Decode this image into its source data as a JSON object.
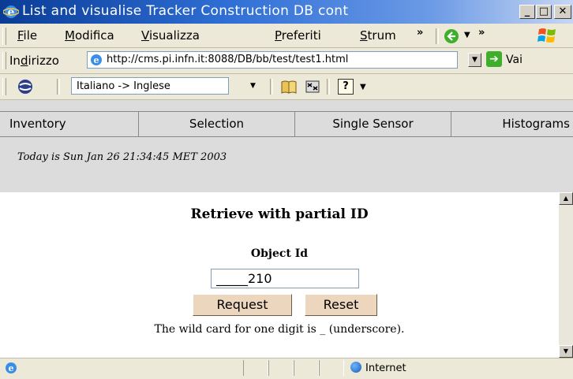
{
  "window": {
    "title": "List and visualise Tracker Construction DB cont",
    "buttons": [
      "_",
      "□",
      "✕"
    ]
  },
  "menu": {
    "items": [
      {
        "label": "File",
        "accel": "F"
      },
      {
        "label": "Modifica",
        "accel": "M"
      },
      {
        "label": "Visualizza",
        "accel": "V"
      },
      {
        "label": "Preferiti",
        "accel": "P"
      },
      {
        "label": "Strum",
        "accel": "S"
      }
    ],
    "overflow": "»",
    "overflow2": "»"
  },
  "address": {
    "label_pre": "In",
    "label_accel": "d",
    "label_post": "irizzo",
    "url": "http://cms.pi.infn.it:8088/DB/bb/test/test1.html",
    "go_label": "Vai"
  },
  "links": {
    "translator": "Italiano -> Inglese"
  },
  "tabs": [
    "Inventory",
    "Selection",
    "Single Sensor",
    "Histograms"
  ],
  "date_text": "Today is Sun Jan 26 21:34:45 MET 2003",
  "form": {
    "heading": "Retrieve with partial ID",
    "object_label": "Object Id",
    "object_value": "_____210",
    "request_label": "Request",
    "reset_label": "Reset",
    "hint": "The wild card for one digit is _ (underscore)."
  },
  "status": {
    "zone": "Internet"
  },
  "colors": {
    "title_gradient_start": "#0a3c96",
    "button_fill": "#ecd6be",
    "content_band": "#dcdcdc"
  }
}
